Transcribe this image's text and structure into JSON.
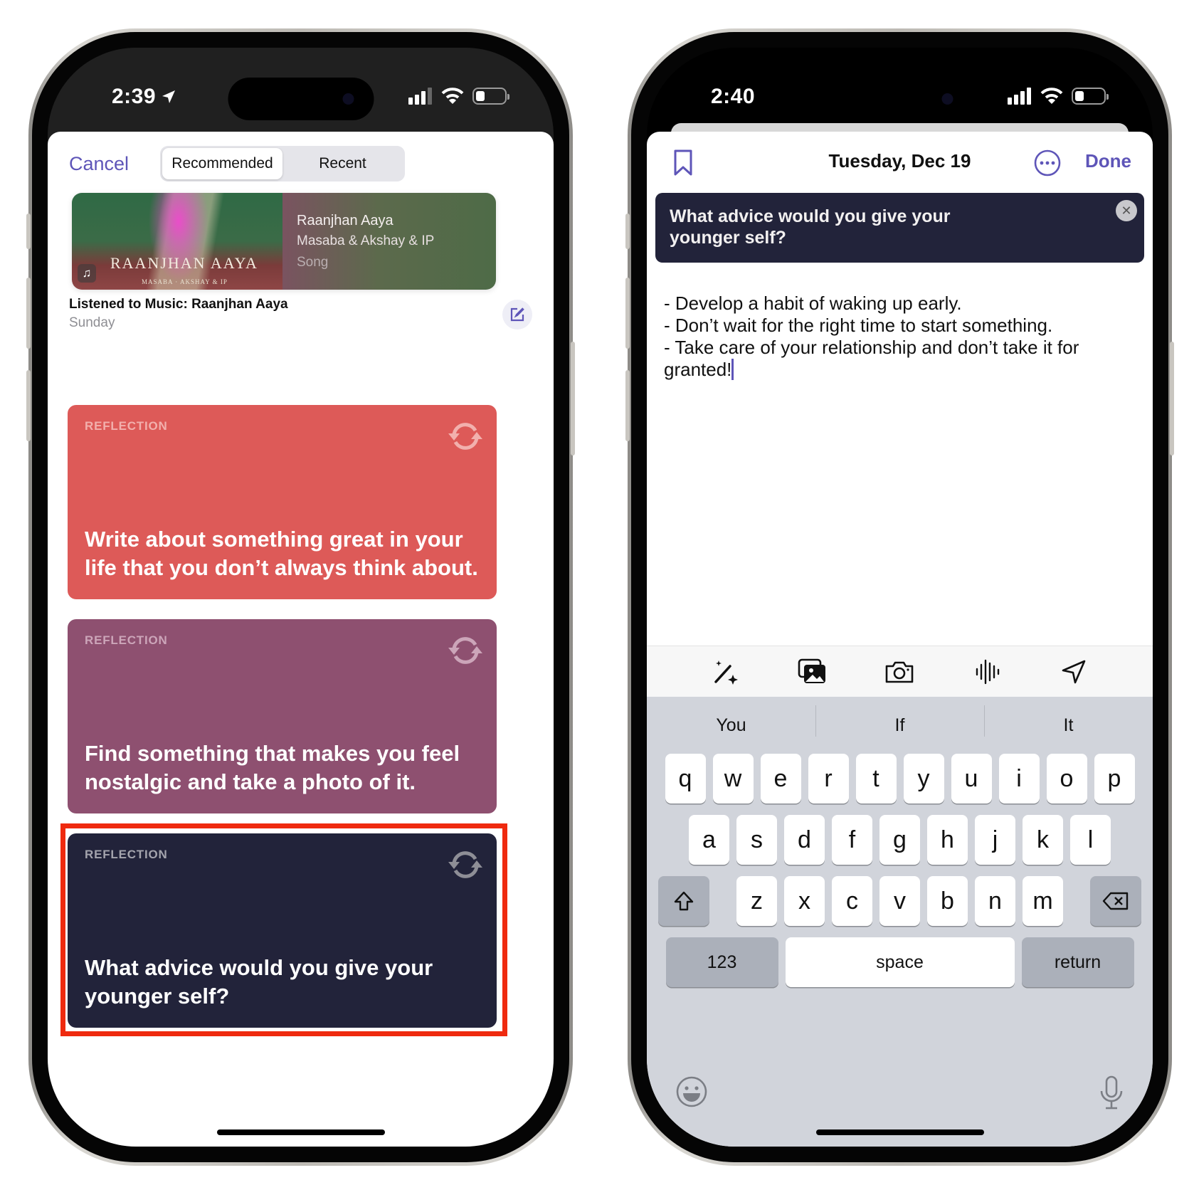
{
  "left_phone": {
    "status": {
      "time": "2:39",
      "location_icon": "location-arrow-icon",
      "signal_icon": "cellular-signal-icon",
      "wifi_icon": "wifi-icon",
      "battery_icon": "battery-icon"
    },
    "header": {
      "cancel_label": "Cancel",
      "tabs": [
        {
          "label": "Recommended",
          "active": true
        },
        {
          "label": "Recent",
          "active": false
        }
      ]
    },
    "music_suggestion": {
      "art_title": "RAANJHAN AAYA",
      "art_subtitle": "MASABA · AKSHAY & IP",
      "song": "Raanjhan Aaya",
      "artist": "Masaba & Akshay & IP",
      "kind": "Song",
      "caption": "Listened to Music: Raanjhan Aaya",
      "date": "Sunday",
      "edit_icon": "compose-icon"
    },
    "prompt_cards": [
      {
        "label": "REFLECTION",
        "text": "Write about something great in your life that you don’t always think about.",
        "color": "#dd5a58"
      },
      {
        "label": "REFLECTION",
        "text": "Find something that makes you feel nostalgic and take a photo of it.",
        "color": "#8e5070"
      },
      {
        "label": "REFLECTION",
        "text": "What advice would you give your younger self?",
        "color": "#22233a",
        "highlighted": true
      }
    ],
    "highlight_color": "#ef2a0f"
  },
  "right_phone": {
    "status": {
      "time": "2:40"
    },
    "header": {
      "date": "Tuesday, Dec 19",
      "done_label": "Done",
      "bookmark_icon": "bookmark-icon",
      "more_icon": "ellipsis-circle-icon"
    },
    "prompt_banner": "What advice would you give your younger self?",
    "entry_text": "- Develop a habit of waking up early.\n- Don’t wait for the right time to start something.\n- Take care of your relationship and don’t take it for granted!",
    "toolbar": [
      "magic-wand-icon",
      "photo-library-icon",
      "camera-icon",
      "audio-waveform-icon",
      "location-icon"
    ],
    "keyboard": {
      "suggestions": [
        "You",
        "If",
        "It"
      ],
      "row1": [
        "q",
        "w",
        "e",
        "r",
        "t",
        "y",
        "u",
        "i",
        "o",
        "p"
      ],
      "row2": [
        "a",
        "s",
        "d",
        "f",
        "g",
        "h",
        "j",
        "k",
        "l"
      ],
      "row3": [
        "z",
        "x",
        "c",
        "v",
        "b",
        "n",
        "m"
      ],
      "numbers_label": "123",
      "space_label": "space",
      "return_label": "return"
    },
    "accent_color": "#5e55b8"
  }
}
